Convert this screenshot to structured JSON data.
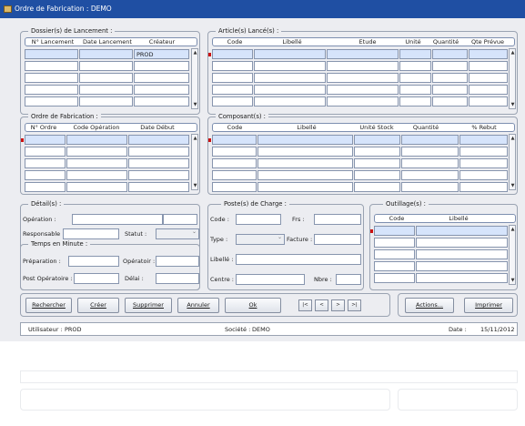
{
  "window": {
    "title": "Ordre de Fabrication : DEMO"
  },
  "dossier": {
    "title": "Dossier(s) de Lancement :",
    "columns": [
      "N° Lancement",
      "Date Lancement",
      "Créateur"
    ],
    "rows": [
      [
        "",
        "",
        "PROD"
      ],
      [
        "",
        "",
        ""
      ],
      [
        "",
        "",
        ""
      ],
      [
        "",
        "",
        ""
      ],
      [
        "",
        "",
        ""
      ]
    ]
  },
  "articles": {
    "title": "Article(s) Lancé(s) :",
    "columns": [
      "Code",
      "Libellé",
      "Etude",
      "Unité",
      "Quantité",
      "Qte Prévue"
    ]
  },
  "ordre": {
    "title": "Ordre de Fabrication :",
    "columns": [
      "N° Ordre",
      "Code Opération",
      "Date Début"
    ]
  },
  "composants": {
    "title": "Composant(s) :",
    "columns": [
      "Code",
      "Libellé",
      "Unité Stock",
      "Quantité",
      "% Rebut"
    ]
  },
  "details": {
    "title": "Détail(s) :",
    "operation_label": "Opération :",
    "responsable_label": "Responsable :",
    "statut_label": "Statut :"
  },
  "temps": {
    "title": "Temps en Minute :",
    "preparation_label": "Préparation :",
    "operatoire_label": "Opératoir :",
    "post_label": "Post Opératoire :",
    "delai_label": "Délai :"
  },
  "poste": {
    "title": "Poste(s) de Charge :",
    "code_label": "Code :",
    "frs_label": "Frs :",
    "type_label": "Type :",
    "facture_label": "Facture :",
    "libelle_label": "Libellé :",
    "centre_label": "Centre :",
    "nbre_label": "Nbre :"
  },
  "outillage": {
    "title": "Outillage(s) :",
    "columns": [
      "Code",
      "Libellé"
    ]
  },
  "buttons": {
    "rechercher": "Rechercher",
    "creer": "Créer",
    "supprimer": "Supprimer",
    "annuler": "Annuler",
    "ok": "Ok",
    "first": "|<",
    "prev": "<",
    "next": ">",
    "last": ">|",
    "actions": "Actions...",
    "imprimer": "Imprimer"
  },
  "status": {
    "utilisateur_label": "Utilisateur :",
    "utilisateur": "PROD",
    "societe_label": "Société :",
    "societe": "DEMO",
    "date_label": "Date :",
    "date": "15/11/2012"
  },
  "colors": {
    "titlebar": "#1f4fa3",
    "selected_cell": "#d6e4fb",
    "marker": "#cc1111"
  }
}
